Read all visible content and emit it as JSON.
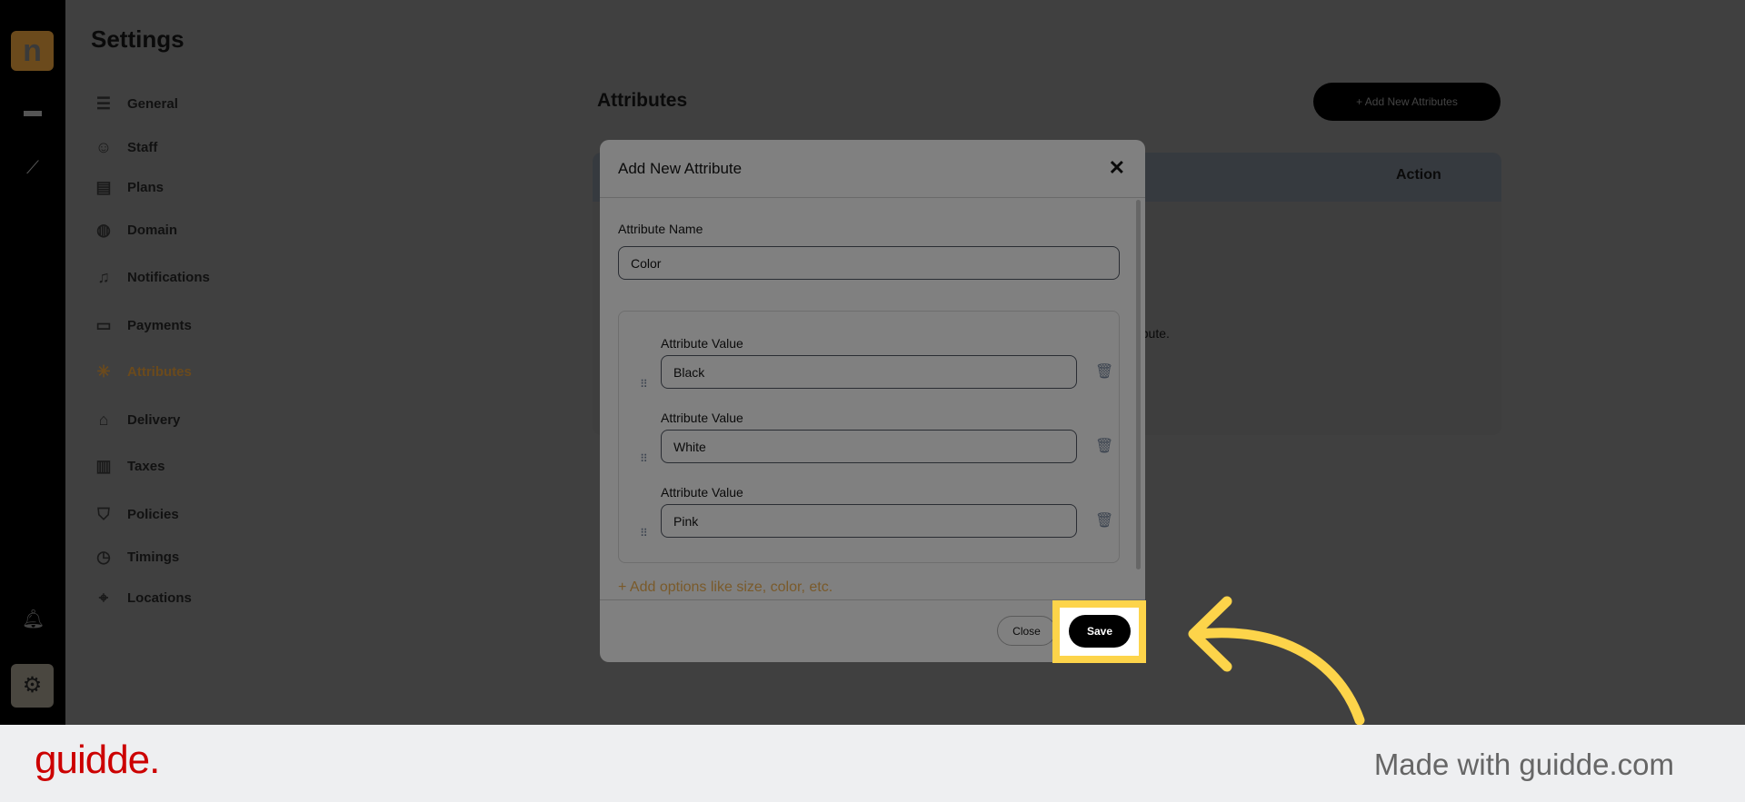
{
  "rail": {
    "logo": "n",
    "icons": [
      "store-icon",
      "chart-icon",
      "bell-icon",
      "gear-icon"
    ]
  },
  "settings": {
    "title": "Settings",
    "items": [
      {
        "label": "General",
        "icon": "sliders-icon",
        "glyph": "☰"
      },
      {
        "label": "Staff",
        "icon": "users-icon",
        "glyph": "☺"
      },
      {
        "label": "Plans",
        "icon": "plans-icon",
        "glyph": "▤"
      },
      {
        "label": "Domain",
        "icon": "globe-icon",
        "glyph": "◍"
      },
      {
        "label": "Notifications",
        "icon": "bell-icon",
        "glyph": "♫"
      },
      {
        "label": "Payments",
        "icon": "wallet-icon",
        "glyph": "▭"
      },
      {
        "label": "Attributes",
        "icon": "snowflake-icon",
        "glyph": "✳",
        "active": true
      },
      {
        "label": "Delivery",
        "icon": "bag-icon",
        "glyph": "⌂"
      },
      {
        "label": "Taxes",
        "icon": "receipt-icon",
        "glyph": "▥"
      },
      {
        "label": "Policies",
        "icon": "shield-icon",
        "glyph": "⛉"
      },
      {
        "label": "Timings",
        "icon": "clock-icon",
        "glyph": "◷"
      },
      {
        "label": "Locations",
        "icon": "location-icon",
        "glyph": "⌖"
      }
    ]
  },
  "main": {
    "title": "Attributes",
    "add_button": "+ Add New Attributes",
    "table_action_header": "Action",
    "empty_text_fragment": "ribute."
  },
  "modal": {
    "title": "Add New Attribute",
    "close_icon": "✕",
    "name_label": "Attribute Name",
    "name_value": "Color",
    "values": [
      {
        "label": "Attribute Value",
        "value": "Black"
      },
      {
        "label": "Attribute Value",
        "value": "White"
      },
      {
        "label": "Attribute Value",
        "value": "Pink"
      }
    ],
    "add_options": "+ Add options like size, color, etc.",
    "close_button": "Close",
    "save_button": "Save"
  },
  "footer": {
    "brand": "guidde.",
    "made_with": "Made with guidde.com"
  },
  "colors": {
    "accent": "#fdd44a",
    "brand": "#cc0000",
    "active": "#6b4a1c"
  }
}
